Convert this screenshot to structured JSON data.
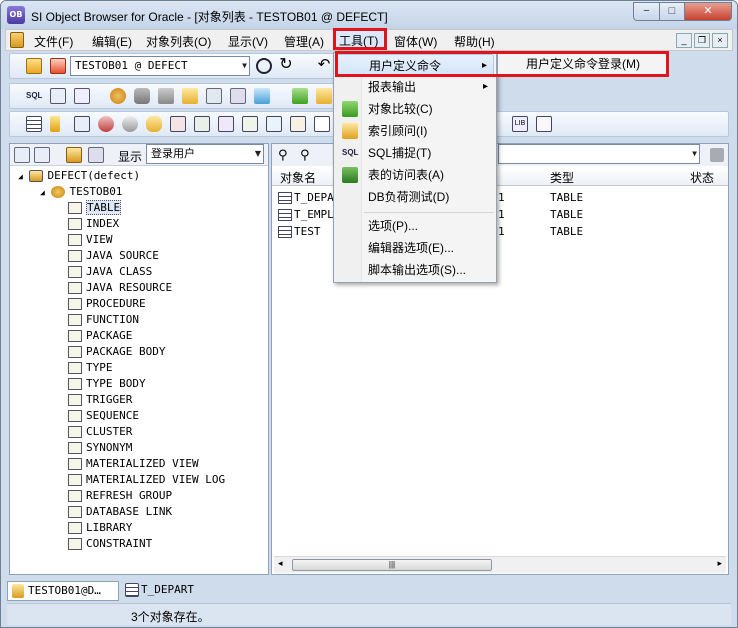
{
  "window": {
    "title": "SI Object Browser for Oracle - [对象列表 - TESTOB01 @ DEFECT]",
    "icon_label": "OB",
    "min_glyph": "−",
    "max_glyph": "□",
    "close_glyph": "✕"
  },
  "menubar": {
    "file": "文件(F)",
    "edit": "编辑(E)",
    "objlist": "对象列表(O)",
    "view": "显示(V)",
    "manage": "管理(A)",
    "tools": "工具(T)",
    "window": "窗体(W)",
    "help": "帮助(H)"
  },
  "toolbar": {
    "connection": "TESTOB01 @ DEFECT"
  },
  "left_pane": {
    "display_label": "显示",
    "display_value": "登录用户",
    "tree": {
      "db": "DEFECT(defect)",
      "user": "TESTOB01",
      "items": [
        "TABLE",
        "INDEX",
        "VIEW",
        "JAVA SOURCE",
        "JAVA CLASS",
        "JAVA RESOURCE",
        "PROCEDURE",
        "FUNCTION",
        "PACKAGE",
        "PACKAGE BODY",
        "TYPE",
        "TYPE BODY",
        "TRIGGER",
        "SEQUENCE",
        "CLUSTER",
        "SYNONYM",
        "MATERIALIZED VIEW",
        "MATERIALIZED VIEW LOG",
        "REFRESH GROUP",
        "DATABASE LINK",
        "LIBRARY",
        "CONSTRAINT"
      ],
      "selected": "TABLE"
    }
  },
  "right_pane": {
    "columns": {
      "name": "对象名",
      "type": "类型",
      "status": "状态"
    },
    "rows": [
      {
        "name": "T_DEPA",
        "num": "1",
        "type": "TABLE"
      },
      {
        "name": "T_EMPL",
        "num": "1",
        "type": "TABLE"
      },
      {
        "name": "TEST",
        "num": "1",
        "type": "TABLE"
      }
    ],
    "scroll_grip": "|||"
  },
  "tools_menu": {
    "items": [
      "用户定义命令",
      "报表输出",
      "对象比较(C)",
      "索引顾问(I)",
      "SQL捕捉(T)",
      "表的访问表(A)",
      "DB负荷测试(D)",
      "选项(P)...",
      "编辑器选项(E)...",
      "脚本输出选项(S)..."
    ],
    "submenu_item": "用户定义命令登录(M)",
    "arrow": "▸"
  },
  "tabs": {
    "tab1": "TESTOB01@D…",
    "tab2": "T_DEPART"
  },
  "status": {
    "text": "3个对象存在。"
  },
  "colors": {
    "highlight": "#e0141c",
    "window_bg": "#cfdcec"
  }
}
